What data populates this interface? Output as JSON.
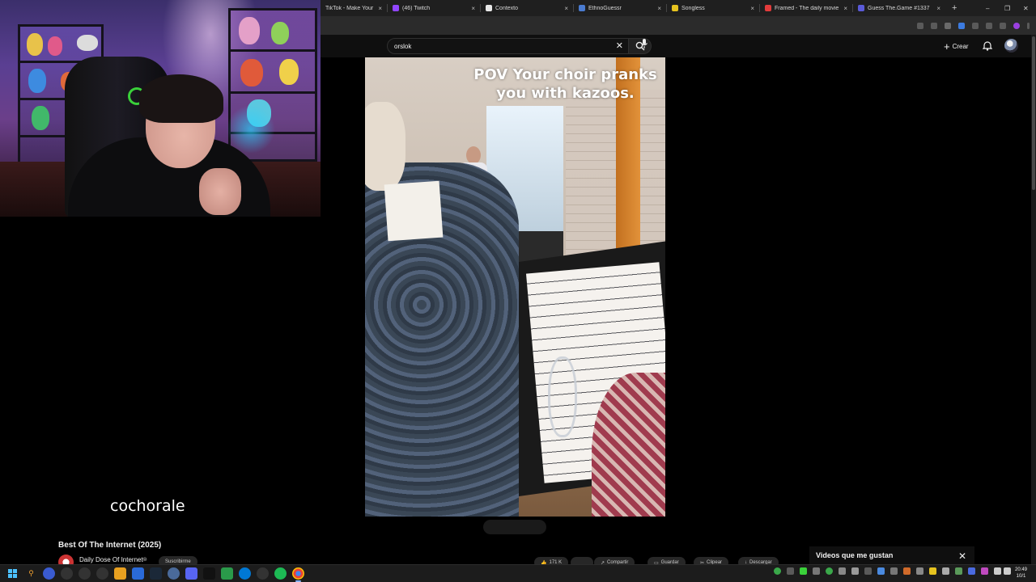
{
  "browser": {
    "tabs": [
      {
        "title": "TikTok - Make Your Day",
        "favicon_color": "#111111"
      },
      {
        "title": "(46) Twitch",
        "favicon_color": "#9146ff"
      },
      {
        "title": "Contexto",
        "favicon_color": "#e8e8e8"
      },
      {
        "title": "EthnoGuessr",
        "favicon_color": "#4a7bd0"
      },
      {
        "title": "Songless",
        "favicon_color": "#e6c31f"
      },
      {
        "title": "Framed - The daily movie gu",
        "favicon_color": "#e33b3b"
      },
      {
        "title": "Guess The.Game #1337",
        "favicon_color": "#5a5ad8"
      }
    ],
    "new_tab": "+",
    "close_glyph": "×",
    "window_controls": {
      "minimize": "–",
      "restore": "❐",
      "close": "✕"
    }
  },
  "youtube": {
    "search_value": "orslok",
    "search_clear": "✕",
    "create_label": "Crear",
    "create_glyph": "+"
  },
  "video": {
    "caption_line1": "POV  Your choir pranks",
    "caption_line2": "you with kazoos."
  },
  "stream": {
    "caption": "cochorale"
  },
  "below": {
    "title": "Best Of The Internet (2025)",
    "channel": "Daily Dose Of Internet",
    "verified": "⊛",
    "subscribe": "Suscribirme",
    "actions": [
      {
        "label": "171 K"
      },
      {
        "label": ""
      },
      {
        "label": "Compartir"
      },
      {
        "label": "Guardar"
      },
      {
        "label": "Clipear"
      },
      {
        "label": "Descargar"
      }
    ],
    "liked_title": "Videos que me gustan",
    "liked_close": "✕"
  },
  "taskbar": {
    "clock_time": "20:49",
    "clock_date": "10/1"
  },
  "colors": {
    "bg": "#000000",
    "yt_header": "#0f0f0f",
    "accent": "#3ea6ff"
  }
}
